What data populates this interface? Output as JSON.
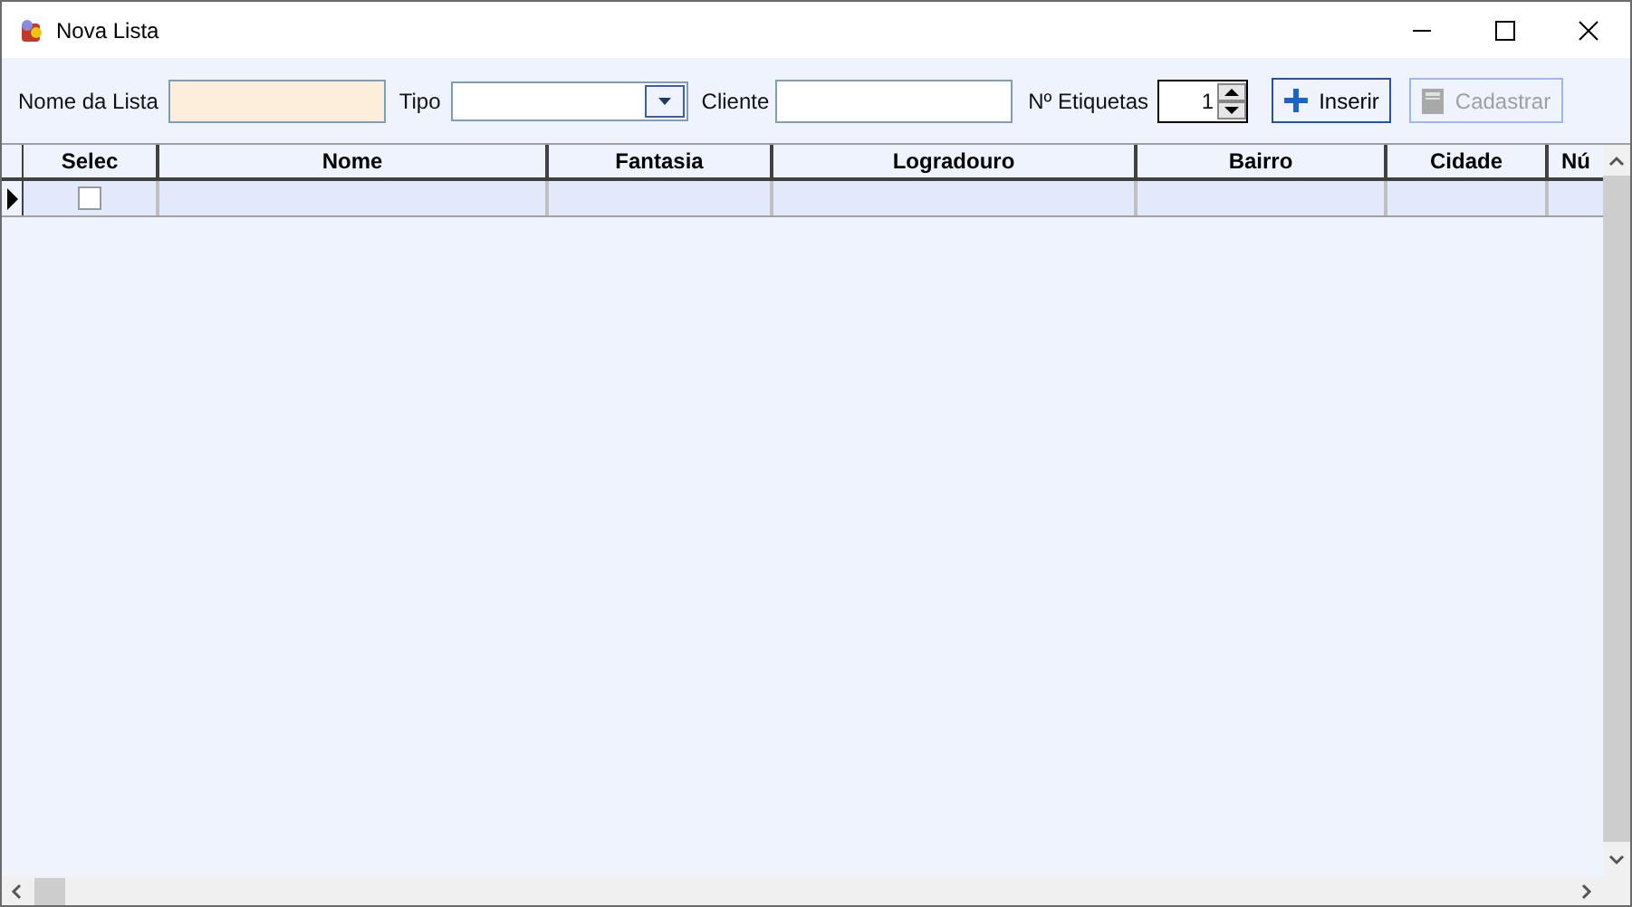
{
  "window": {
    "title": "Nova Lista"
  },
  "toolbar": {
    "nome_da_lista": {
      "label": "Nome da Lista"
    },
    "tipo": {
      "label": "Tipo"
    },
    "cliente": {
      "label": "Cliente"
    },
    "etiquetas": {
      "label": "Nº Etiquetas",
      "value": "1"
    },
    "buttons": [
      {
        "label": "Inserir",
        "kind": "add",
        "disabled": false
      },
      {
        "label": "Cadastrar",
        "kind": "save",
        "disabled": true
      }
    ]
  },
  "table": {
    "columns": [
      "Selec",
      "Nome",
      "Fantasia",
      "Logradouro",
      "Bairro",
      "Cidade",
      "Nú"
    ],
    "rows": [
      {
        "current": true,
        "selec": {
          "checked": false
        }
      }
    ]
  }
}
